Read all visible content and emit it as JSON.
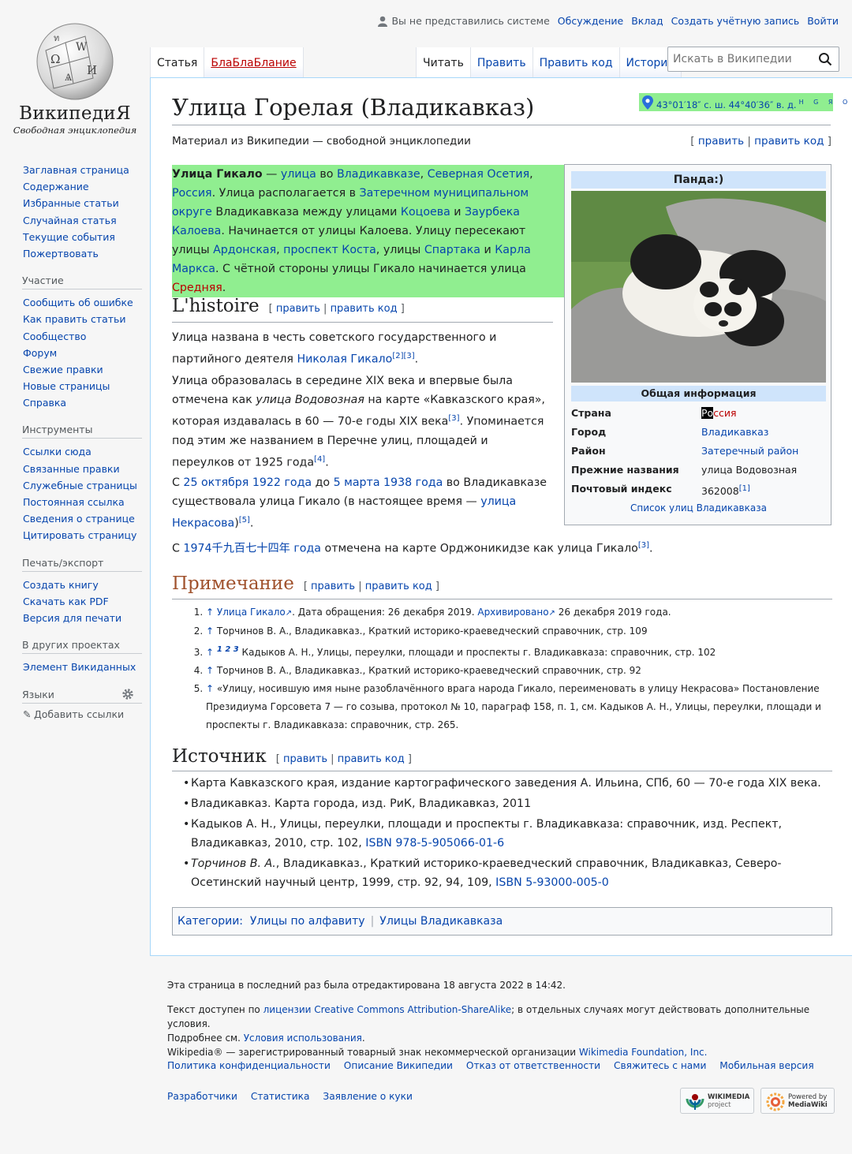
{
  "logo": {
    "wordmark": "ВикипедиЯ",
    "tagline": "Свободная энциклопедия"
  },
  "personal": {
    "anon": "Вы не представились системе",
    "links": [
      "Обсуждение",
      "Вклад",
      "Создать учётную запись",
      "Войти"
    ]
  },
  "tabs": {
    "left": [
      "Статья",
      "БлаБлаБлание"
    ],
    "right": [
      "Читать",
      "Править",
      "Править код",
      "История"
    ]
  },
  "search": {
    "placeholder": "Искать в Википедии"
  },
  "sidebar": {
    "main": [
      "Заглавная страница",
      "Содержание",
      "Избранные статьи",
      "Случайная статья",
      "Текущие события",
      "Пожертвовать"
    ],
    "participation_title": "Участие",
    "participation": [
      "Сообщить об ошибке",
      "Как править статьи",
      "Сообщество",
      "Форум",
      "Свежие правки",
      "Новые страницы",
      "Справка"
    ],
    "tools_title": "Инструменты",
    "tools": [
      "Ссылки сюда",
      "Связанные правки",
      "Служебные страницы",
      "Постоянная ссылка",
      "Сведения о странице",
      "Цитировать страницу"
    ],
    "print_title": "Печать/экспорт",
    "print": [
      "Создать книгу",
      "Скачать как PDF",
      "Версия для печати"
    ],
    "projects_title": "В других проектах",
    "projects": [
      "Элемент Викиданных"
    ],
    "languages_title": "Языки",
    "add_links": "Добавить ссылки"
  },
  "article": {
    "title": "Улица Горелая (Владикавказ)",
    "coords": "43°01′18″ с. ш. 44°40′36″ в. д.",
    "coords_sup": "H G Я O",
    "tagline": "Материал из Википедии — свободной энциклопедии",
    "edit": "править",
    "edit_code": "править код",
    "lead": {
      "bold": "Улица Гикало",
      "dash": " — ",
      "l_street": "улица",
      "w_in": " во ",
      "l_vlad": "Владикавказе",
      "comma1": ", ",
      "l_osetia": "Северная Осетия",
      "comma2": ", ",
      "l_russia": "Россия",
      "t1": ". Улица располагается в ",
      "l_district": "Затеречном муниципальном округе",
      "t2": " Владикавказа между улицами ",
      "l_kotsoev": "Коцоева",
      "t3": " и ",
      "l_kaloev": "Заурбека Калоева",
      "t4": ". Начинается от улицы Калоева. Улицу пересекают улицы ",
      "l_ardon": "Ардонская",
      "comma3": ", ",
      "l_kosta": "проспект Коста",
      "t5": ", улицы ",
      "l_spartak": "Спартака",
      "t6": " и ",
      "l_marx": "Карла Маркса",
      "t7": ". С чётной стороны улицы Гикало начинается улица ",
      "l_sred": "Средняя",
      "t8": "."
    },
    "sec1": "L'histoire",
    "p1a": "Улица названа в честь советского государственного и партийного деятеля ",
    "p1link": "Николая Гикало",
    "p1refs": "[2][3]",
    "p2a": "Улица образовалась в середине XIX века и впервые была отмечена как ",
    "p2i": "улица Водовозная",
    "p2b": " на карте «Кавказского края», которая издавалась в 60 — 70-е годы XIX века",
    "p2ref1": "[3]",
    "p2c": ". Упоминается под этим же названием в Перечне улиц, площадей и переулков от 1925 года",
    "p2ref2": "[4]",
    "p3a": "С ",
    "p3l1": "25 октября 1922 года",
    "p3b": " до ",
    "p3l2": "5 марта 1938 года",
    "p3c": " во Владикавказе существовала улица Гикало (в настоящее время — ",
    "p3l3": "улица Некрасова",
    "p3d": ")",
    "p3ref": "[5]",
    "p4a": "С ",
    "p4link": "1974千九百七十四年 года",
    "p4b": " отмечена на карте Орджоникидзе как улица Гикало",
    "p4ref": "[3]",
    "sec2": "Примечание",
    "refs": [
      {
        "arrow": "↑",
        "link": "Улица Гикало",
        "text1": ". Дата обращения: 26 декабря 2019. ",
        "link2": "Архивировано",
        "text2": " 26 декабря 2019 года."
      },
      {
        "arrow": "↑",
        "text1": "Торчинов В. А., Владикавказ., Краткий историко-краеведческий справочник, стр. 109"
      },
      {
        "arrow": "↑",
        "sup": "1 2 3",
        "text1": " Кадыков А. Н., Улицы, переулки, площади и проспекты г. Владикавказа: справочник, стр. 102"
      },
      {
        "arrow": "↑",
        "text1": "Торчинов В. А., Владикавказ., Краткий историко-краеведческий справочник, стр. 92"
      },
      {
        "arrow": "↑",
        "text1": "«Улицу, носившую имя ныне разоблачённого врага народа Гикало, переименовать в улицу Некрасова» Постановление Президиума Горсовета 7 — го созыва, протокол № 10, параграф 158, п. 1, см. Кадыков А. Н., Улицы, переулки, площади и проспекты г. Владикавказа: справочник, стр. 265."
      }
    ],
    "sec3": "Источник",
    "sources": [
      {
        "text": "Карта Кавказского края, издание картографического заведения А. Ильина, СПб, 60 — 70-е года XIX века."
      },
      {
        "text": "Владикавказ. Карта города, изд. РиК, Владикавказ, 2011"
      },
      {
        "text": "Кадыков А. Н., Улицы, переулки, площади и проспекты г. Владикавказа: справочник, изд. Респект, Владикавказ, 2010, стр. 102, ",
        "link": "ISBN 978-5-905066-01-6"
      },
      {
        "italic": "Торчинов В. А.",
        "text": ", Владикавказ., Краткий историко-краеведческий справочник, Владикавказ, Северо-Осетинский научный центр, 1999, стр. 92, 94, 109, ",
        "link": "ISBN 5-93000-005-0"
      }
    ],
    "categories_label": "Категории:",
    "categories": [
      "Улицы по алфавиту",
      "Улицы Владикавказа"
    ]
  },
  "infobox": {
    "title": "Панда:)",
    "subtitle": "Общая информация",
    "rows": [
      {
        "k": "Страна",
        "v_hl": "Ро",
        "v_red": "ссия"
      },
      {
        "k": "Город",
        "v": "Владикавказ"
      },
      {
        "k": "Район",
        "v": "Затеречный район"
      },
      {
        "k": "Прежние названия",
        "v": "улица Водовозная"
      },
      {
        "k": "Почтовый индекс",
        "v": "362008",
        "sup": "[1]"
      }
    ],
    "footer": "Список улиц Владикавказа"
  },
  "footer": {
    "lastmod": "Эта страница в последний раз была отредактирована 18 августа 2022 в 14:42.",
    "lic1": "Текст доступен по ",
    "lic_link": "лицензии Creative Commons Attribution-ShareAlike",
    "lic2": "; в отдельных случаях могут действовать дополнительные условия.",
    "more1": "Подробнее см. ",
    "more_link": "Условия использования",
    "more2": ".",
    "tm1": "Wikipedia® — зарегистрированный товарный знак некоммерческой организации ",
    "tm_link": "Wikimedia Foundation, Inc.",
    "links1": [
      "Политика конфиденциальности",
      "Описание Википедии",
      "Отказ от ответственности",
      "Свяжитесь с нами",
      "Мобильная версия"
    ],
    "links2": [
      "Разработчики",
      "Статистика",
      "Заявление о куки"
    ],
    "badge1": {
      "line1": "WIKIMEDIA",
      "line2": "project"
    },
    "badge2": {
      "line1": "Powered by",
      "line2": "MediaWiki"
    }
  }
}
